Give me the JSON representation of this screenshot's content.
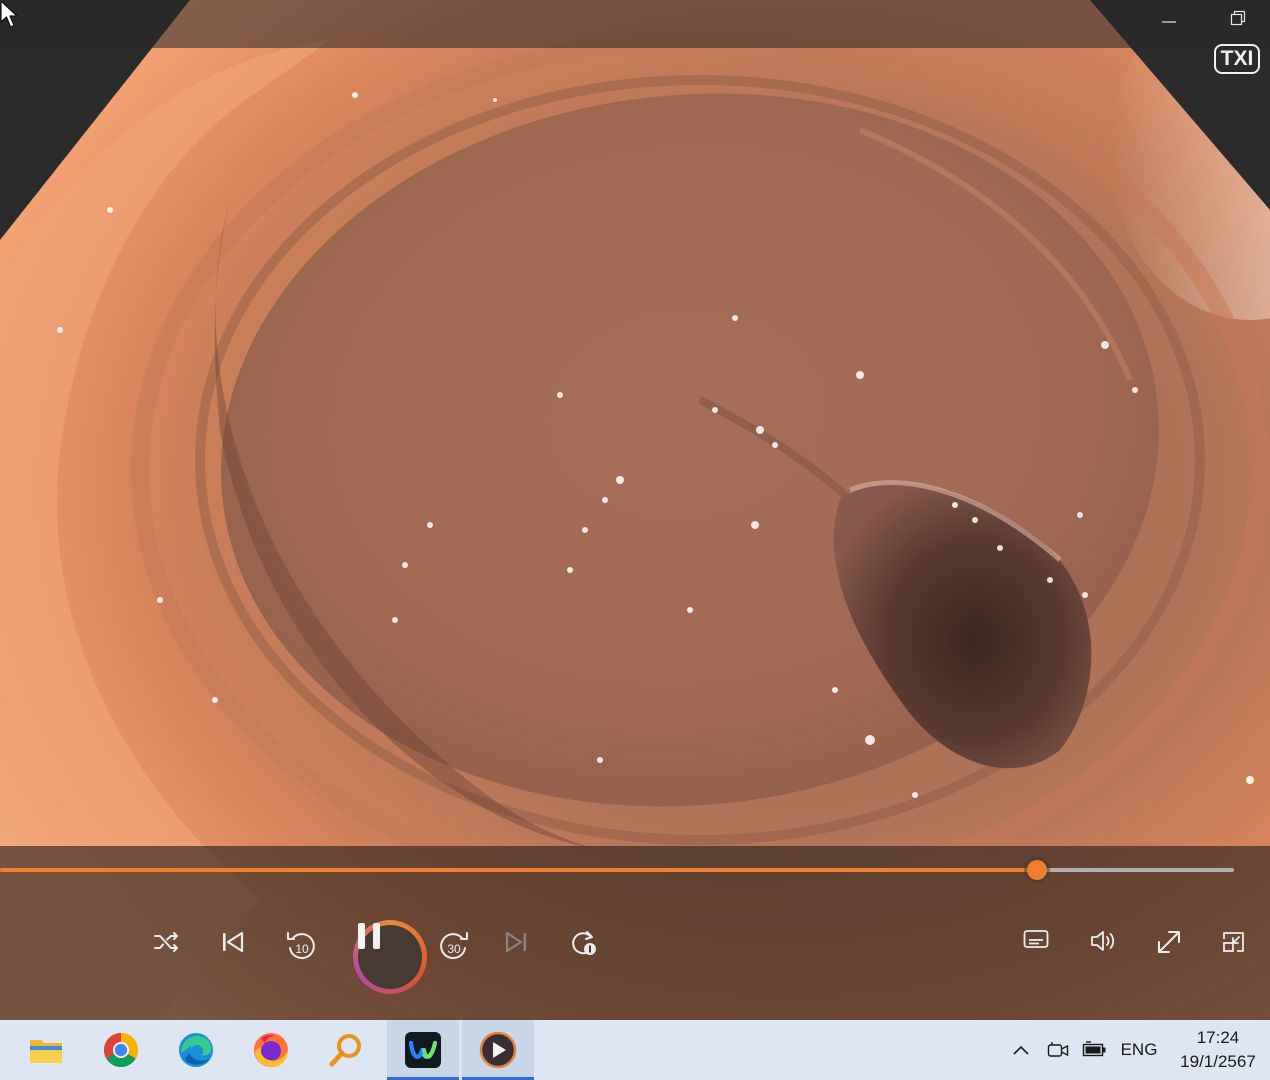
{
  "window": {
    "badge": "TXI",
    "controls": [
      "minimize-icon",
      "restore-icon"
    ]
  },
  "player": {
    "progress": 0.84,
    "skip_back_label": "10",
    "skip_forward_label": "30",
    "state": "playing",
    "accent_color": "#ee7f2e",
    "left_controls": [
      "shuffle-icon",
      "previous-icon",
      "rewind-10-icon",
      "pause-icon",
      "forward-30-icon",
      "next-icon",
      "repeat-once-icon"
    ],
    "right_controls": [
      "subtitles-icon",
      "volume-icon",
      "fullscreen-icon",
      "mini-view-icon"
    ]
  },
  "taskbar": {
    "apps": [
      "file-explorer-icon",
      "chrome-icon",
      "edge-icon",
      "firefox-icon",
      "search-app-icon",
      "webex-icon",
      "media-player-icon"
    ],
    "active_apps": [
      "webex-icon",
      "media-player-icon"
    ],
    "tray": {
      "language": "ENG",
      "time": "17:24",
      "date": "19/1/2567"
    }
  }
}
